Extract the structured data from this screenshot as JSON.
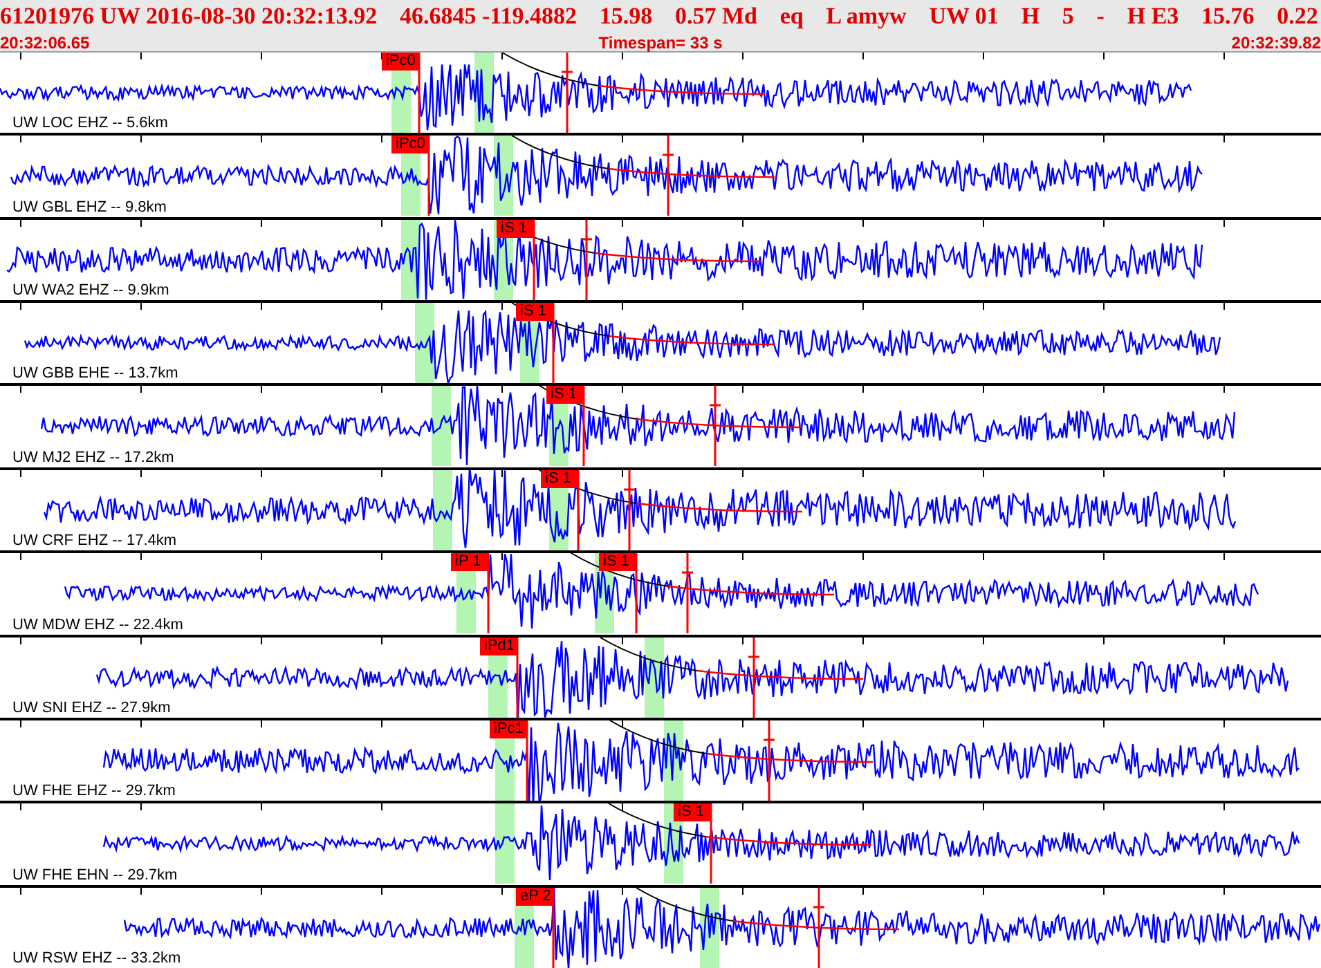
{
  "header": {
    "event": [
      "61201976 UW 2016-08-30 20:32:13.92",
      "46.6845 -119.4882",
      "15.98",
      "0.57 Md",
      "eq",
      "L amyw",
      "UW 01",
      "H",
      "5",
      "-",
      "H E3",
      "15.76",
      "0.22"
    ],
    "start_time": "20:32:06.65",
    "timespan": "Timespan=  33 s",
    "end_time": "20:32:39.82"
  },
  "traces": [
    {
      "station": "UW LOC EHZ -- 5.6km",
      "picks": [
        "iPc0"
      ]
    },
    {
      "station": "UW GBL EHZ -- 9.8km",
      "picks": [
        "iPc0"
      ]
    },
    {
      "station": "UW WA2 EHZ -- 9.9km",
      "picks": [
        "iS 1"
      ]
    },
    {
      "station": "UW GBB EHE -- 13.7km",
      "picks": [
        "iS 1"
      ]
    },
    {
      "station": "UW MJ2 EHZ -- 17.2km",
      "picks": [
        "iS 1"
      ]
    },
    {
      "station": "UW CRF EHZ -- 17.4km",
      "picks": [
        "iS 1"
      ]
    },
    {
      "station": "UW MDW EHZ -- 22.4km",
      "picks": [
        "iP 1",
        "iS 1"
      ]
    },
    {
      "station": "UW SNI EHZ -- 27.9km",
      "picks": [
        "iPd1"
      ]
    },
    {
      "station": "UW FHE EHZ -- 29.7km",
      "picks": [
        "iPc1"
      ]
    },
    {
      "station": "UW FHE EHN -- 29.7km",
      "picks": [
        "iS 1"
      ]
    },
    {
      "station": "UW RSW EHZ -- 33.2km",
      "picks": [
        "eP 2"
      ]
    }
  ]
}
